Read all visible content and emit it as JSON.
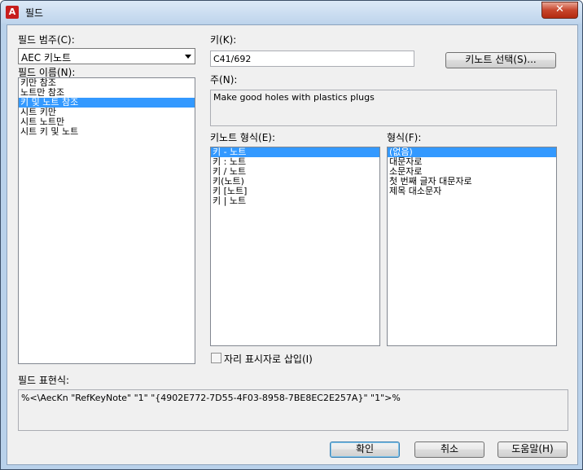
{
  "window": {
    "title": "필드",
    "close_glyph": "✕",
    "app_icon": "autocad-icon"
  },
  "field_category": {
    "label": "필드 범주(C):",
    "selected": "AEC 키노트"
  },
  "field_names": {
    "label": "필드 이름(N):",
    "items": [
      "키만 참조",
      "노트만 참조",
      "키 및 노트 참조",
      "시트 키만",
      "시트 노트만",
      "시트 키 및 노트"
    ],
    "selected_index": 2
  },
  "key": {
    "label": "키(K):",
    "value": "C41/692"
  },
  "keynote_select_button": "키노트 선택(S)...",
  "note": {
    "label": "주(N):",
    "value": "Make good holes with plastics plugs"
  },
  "keynote_format": {
    "label": "키노트 형식(E):",
    "items": [
      "키 - 노트",
      "키 : 노트",
      "키 / 노트",
      "키(노트)",
      "키 [노트]",
      "키 | 노트"
    ],
    "selected_index": 0
  },
  "format": {
    "label": "형식(F):",
    "items": [
      "(없음)",
      "대문자로",
      "소문자로",
      "첫 번째 글자 대문자로",
      "제목 대소문자"
    ],
    "selected_index": 0
  },
  "placeholder_checkbox": {
    "label": "자리 표시자로 삽입(I)",
    "checked": false
  },
  "field_expression": {
    "label": "필드 표현식:",
    "value": "%<\\AecKn \"RefKeyNote\" \"1\" \"{4902E772-7D55-4F03-8958-7BE8EC2E257A}\" \"1\">%"
  },
  "buttons": {
    "ok": "확인",
    "cancel": "취소",
    "help": "도움말(H)"
  }
}
